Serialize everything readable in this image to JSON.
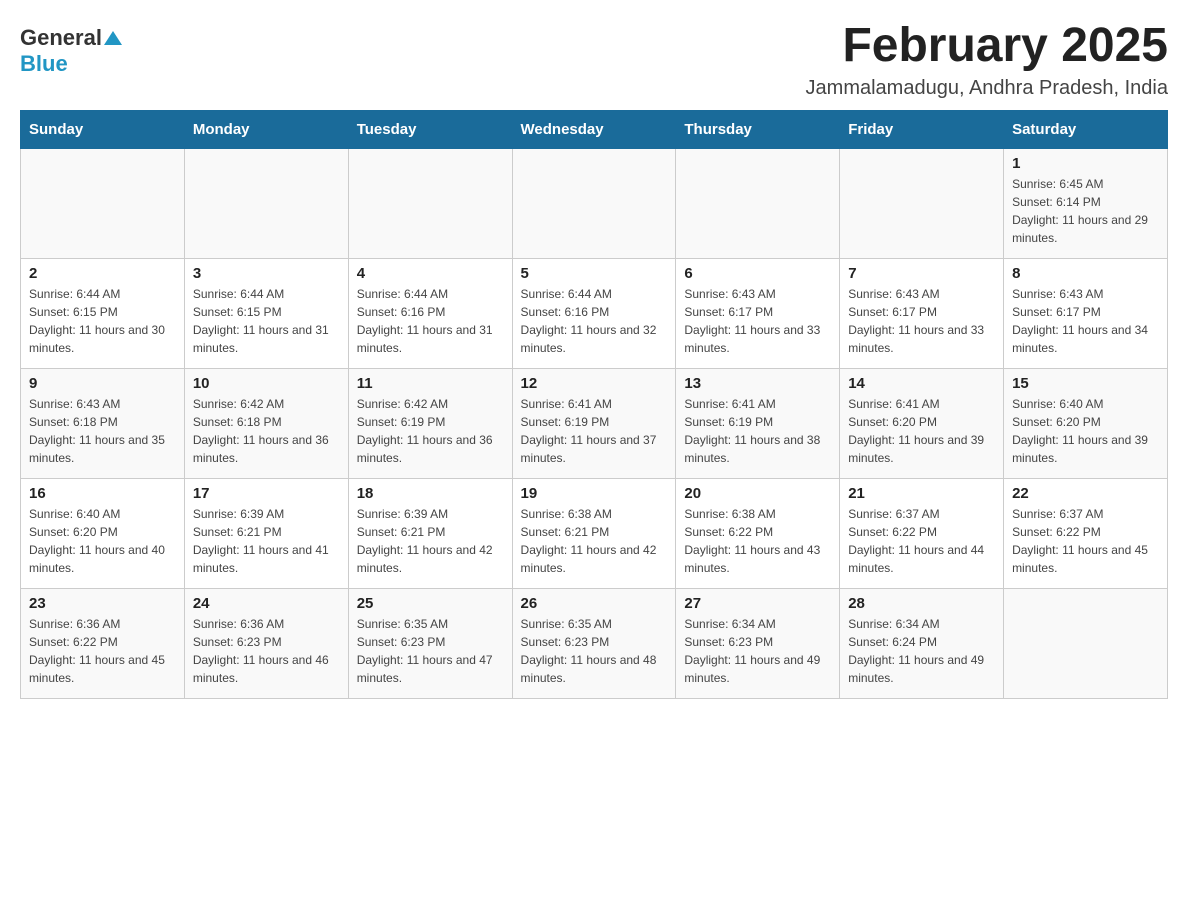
{
  "header": {
    "logo": {
      "general": "General",
      "blue": "Blue",
      "arrow": "▲"
    },
    "title": "February 2025",
    "location": "Jammalamadugu, Andhra Pradesh, India"
  },
  "calendar": {
    "days_of_week": [
      "Sunday",
      "Monday",
      "Tuesday",
      "Wednesday",
      "Thursday",
      "Friday",
      "Saturday"
    ],
    "weeks": [
      [
        {
          "day": "",
          "info": ""
        },
        {
          "day": "",
          "info": ""
        },
        {
          "day": "",
          "info": ""
        },
        {
          "day": "",
          "info": ""
        },
        {
          "day": "",
          "info": ""
        },
        {
          "day": "",
          "info": ""
        },
        {
          "day": "1",
          "info": "Sunrise: 6:45 AM\nSunset: 6:14 PM\nDaylight: 11 hours and 29 minutes."
        }
      ],
      [
        {
          "day": "2",
          "info": "Sunrise: 6:44 AM\nSunset: 6:15 PM\nDaylight: 11 hours and 30 minutes."
        },
        {
          "day": "3",
          "info": "Sunrise: 6:44 AM\nSunset: 6:15 PM\nDaylight: 11 hours and 31 minutes."
        },
        {
          "day": "4",
          "info": "Sunrise: 6:44 AM\nSunset: 6:16 PM\nDaylight: 11 hours and 31 minutes."
        },
        {
          "day": "5",
          "info": "Sunrise: 6:44 AM\nSunset: 6:16 PM\nDaylight: 11 hours and 32 minutes."
        },
        {
          "day": "6",
          "info": "Sunrise: 6:43 AM\nSunset: 6:17 PM\nDaylight: 11 hours and 33 minutes."
        },
        {
          "day": "7",
          "info": "Sunrise: 6:43 AM\nSunset: 6:17 PM\nDaylight: 11 hours and 33 minutes."
        },
        {
          "day": "8",
          "info": "Sunrise: 6:43 AM\nSunset: 6:17 PM\nDaylight: 11 hours and 34 minutes."
        }
      ],
      [
        {
          "day": "9",
          "info": "Sunrise: 6:43 AM\nSunset: 6:18 PM\nDaylight: 11 hours and 35 minutes."
        },
        {
          "day": "10",
          "info": "Sunrise: 6:42 AM\nSunset: 6:18 PM\nDaylight: 11 hours and 36 minutes."
        },
        {
          "day": "11",
          "info": "Sunrise: 6:42 AM\nSunset: 6:19 PM\nDaylight: 11 hours and 36 minutes."
        },
        {
          "day": "12",
          "info": "Sunrise: 6:41 AM\nSunset: 6:19 PM\nDaylight: 11 hours and 37 minutes."
        },
        {
          "day": "13",
          "info": "Sunrise: 6:41 AM\nSunset: 6:19 PM\nDaylight: 11 hours and 38 minutes."
        },
        {
          "day": "14",
          "info": "Sunrise: 6:41 AM\nSunset: 6:20 PM\nDaylight: 11 hours and 39 minutes."
        },
        {
          "day": "15",
          "info": "Sunrise: 6:40 AM\nSunset: 6:20 PM\nDaylight: 11 hours and 39 minutes."
        }
      ],
      [
        {
          "day": "16",
          "info": "Sunrise: 6:40 AM\nSunset: 6:20 PM\nDaylight: 11 hours and 40 minutes."
        },
        {
          "day": "17",
          "info": "Sunrise: 6:39 AM\nSunset: 6:21 PM\nDaylight: 11 hours and 41 minutes."
        },
        {
          "day": "18",
          "info": "Sunrise: 6:39 AM\nSunset: 6:21 PM\nDaylight: 11 hours and 42 minutes."
        },
        {
          "day": "19",
          "info": "Sunrise: 6:38 AM\nSunset: 6:21 PM\nDaylight: 11 hours and 42 minutes."
        },
        {
          "day": "20",
          "info": "Sunrise: 6:38 AM\nSunset: 6:22 PM\nDaylight: 11 hours and 43 minutes."
        },
        {
          "day": "21",
          "info": "Sunrise: 6:37 AM\nSunset: 6:22 PM\nDaylight: 11 hours and 44 minutes."
        },
        {
          "day": "22",
          "info": "Sunrise: 6:37 AM\nSunset: 6:22 PM\nDaylight: 11 hours and 45 minutes."
        }
      ],
      [
        {
          "day": "23",
          "info": "Sunrise: 6:36 AM\nSunset: 6:22 PM\nDaylight: 11 hours and 45 minutes."
        },
        {
          "day": "24",
          "info": "Sunrise: 6:36 AM\nSunset: 6:23 PM\nDaylight: 11 hours and 46 minutes."
        },
        {
          "day": "25",
          "info": "Sunrise: 6:35 AM\nSunset: 6:23 PM\nDaylight: 11 hours and 47 minutes."
        },
        {
          "day": "26",
          "info": "Sunrise: 6:35 AM\nSunset: 6:23 PM\nDaylight: 11 hours and 48 minutes."
        },
        {
          "day": "27",
          "info": "Sunrise: 6:34 AM\nSunset: 6:23 PM\nDaylight: 11 hours and 49 minutes."
        },
        {
          "day": "28",
          "info": "Sunrise: 6:34 AM\nSunset: 6:24 PM\nDaylight: 11 hours and 49 minutes."
        },
        {
          "day": "",
          "info": ""
        }
      ]
    ]
  }
}
